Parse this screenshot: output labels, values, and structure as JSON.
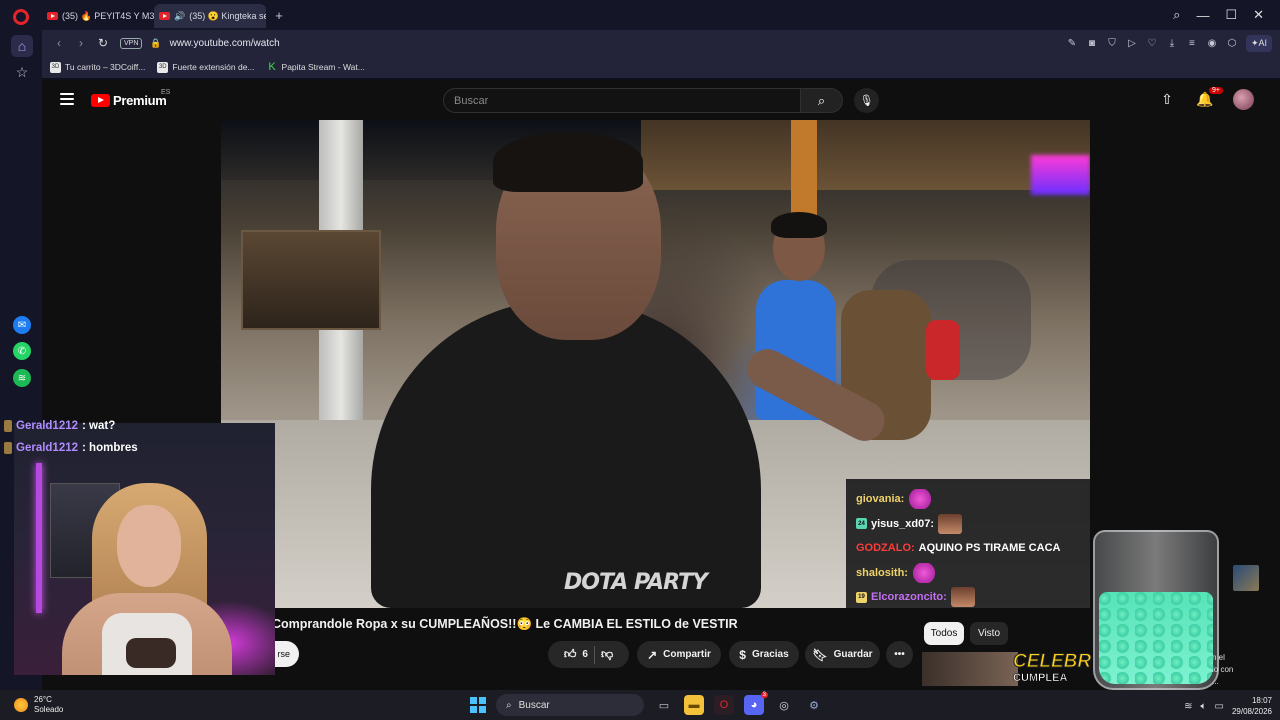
{
  "browser": {
    "tabs": [
      {
        "label": "(35) 🔥 PEYIT4S Y M3CHA"
      },
      {
        "label": "(35) 😮 Kingteka se G"
      }
    ],
    "new_tab": "+",
    "url": "www.youtube.com/watch",
    "vpn": "VPN",
    "ai_label": "AI",
    "bookmarks": [
      {
        "label": "Tu carrito – 3DCoiff...",
        "favicon": "3D"
      },
      {
        "label": "Fuerte extensión de...",
        "favicon": "3D"
      },
      {
        "label": "Papita Stream - Wat...",
        "favicon": "K"
      }
    ]
  },
  "youtube": {
    "logo_text": "Premium",
    "region": "ES",
    "search_placeholder": "Buscar",
    "notifications_badge": "9+",
    "video_watermark": "DOTA PARTY",
    "video_title": "Comprandole Ropa x su CUMPLEAÑOS!!😳 Le CAMBIA EL ESTILO de VESTIR",
    "subscribe_label": "rse",
    "likes": "6",
    "share_label": "Compartir",
    "thanks_label": "Gracias",
    "save_label": "Guardar",
    "more_label": "•••",
    "chips": [
      "Todos",
      "Visto"
    ],
    "related_thumb_text": "CELEBR",
    "related_thumb_sub": "CUMPLEA",
    "related_side_text": [
      "n el",
      "lo con",
      "..."
    ]
  },
  "video_chat": [
    {
      "user": "giovania:",
      "user_color": "#f0d26a",
      "badge": "",
      "msg": "",
      "emote": "pink"
    },
    {
      "user": "yisus_xd07:",
      "user_color": "#ffffff",
      "badge": "24",
      "badge_color": "#5ad6b0",
      "msg": "",
      "emote": "face"
    },
    {
      "user": "GODZALO:",
      "user_color": "#ff3b3b",
      "badge": "",
      "msg": "AQUINO PS TIRAME CACA",
      "emote": ""
    },
    {
      "user": "shalosith:",
      "user_color": "#f0d26a",
      "badge": "",
      "msg": "",
      "emote": "pink"
    },
    {
      "user": "Elcorazoncito:",
      "user_color": "#c06ff0",
      "badge": "19",
      "badge_color": "#f0d26a",
      "msg": "",
      "emote": "face"
    }
  ],
  "stream_chat": [
    {
      "user": "Gerald1212",
      "msg": ": wat?"
    },
    {
      "user": "Gerald1212",
      "msg": ": hombres"
    }
  ],
  "taskbar": {
    "temperature": "26°C",
    "weather": "Soleado",
    "search": "Buscar",
    "time": "18:07",
    "date": "29/08/2026",
    "discord_badge": "3"
  }
}
